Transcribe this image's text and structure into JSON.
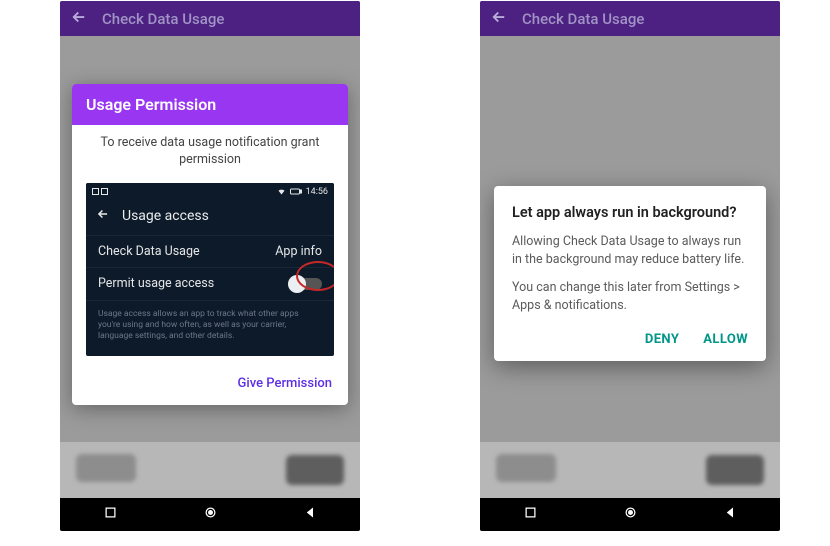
{
  "left": {
    "appbar_title": "Check Data Usage",
    "dialog": {
      "header": "Usage Permission",
      "subtext": "To receive data usage notification grant permission",
      "give_permission": "Give Permission"
    },
    "mock": {
      "time": "14:56",
      "header_title": "Usage access",
      "row_app_name": "Check Data Usage",
      "row_app_info": "App info",
      "row_permit_label": "Permit usage access",
      "fine_print": "Usage access allows an app to track what other apps you're using and how often, as well as your carrier, language settings, and other details."
    }
  },
  "right": {
    "appbar_title": "Check Data Usage",
    "dialog": {
      "title": "Let app always run in background?",
      "p1": "Allowing Check Data Usage to always run in the background may reduce battery life.",
      "p2": "You can change this later from Settings > Apps & notifications.",
      "deny": "DENY",
      "allow": "ALLOW"
    }
  }
}
